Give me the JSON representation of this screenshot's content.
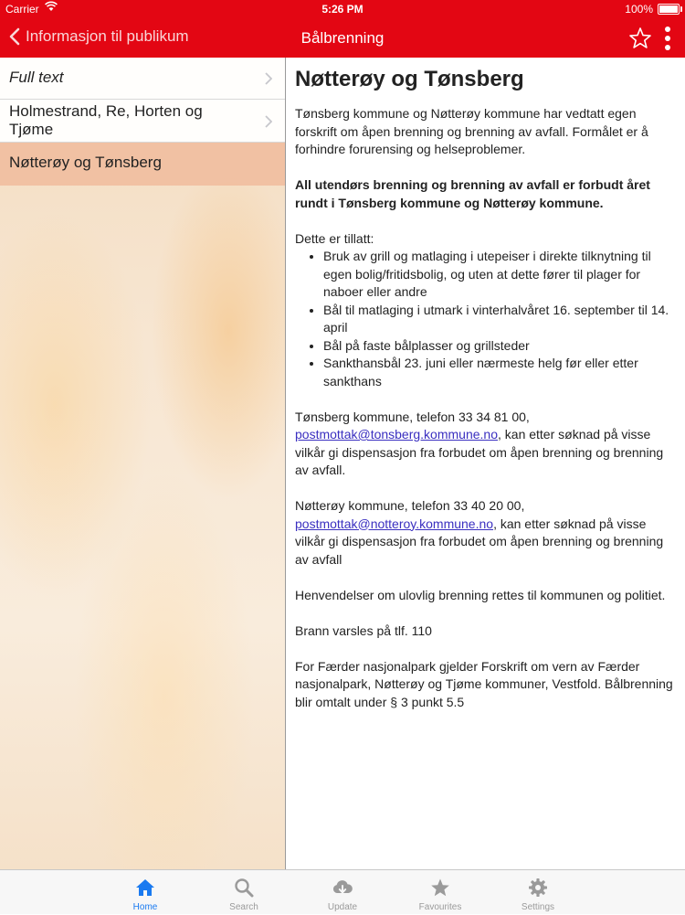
{
  "status_bar": {
    "carrier": "Carrier",
    "time": "5:26 PM",
    "battery": "100%",
    "battery_level": 1.0
  },
  "nav": {
    "back_label": "Informasjon til publikum",
    "title": "Bålbrenning",
    "star_icon": "star-outline-icon",
    "more_icon": "vertical-ellipsis-icon"
  },
  "sidebar": {
    "items": [
      {
        "label": "Full text",
        "has_chevron": true
      },
      {
        "label": "Holmestrand, Re, Horten og Tjøme",
        "has_chevron": true
      },
      {
        "label": "Nøtterøy og Tønsberg",
        "selected": true
      }
    ]
  },
  "content": {
    "heading": "Nøtterøy og Tønsberg",
    "intro": "Tønsberg kommune og Nøtterøy kommune har vedtatt egen forskrift om åpen brenning og brenning av avfall. Formålet er å forhindre forurensing og helseproblemer.",
    "ban": "All utendørs brenning og brenning av avfall er forbudt året rundt i Tønsberg kommune og Nøtterøy kommune.",
    "allowed_heading": "Dette er tillatt:",
    "allowed": [
      "Bruk av grill og matlaging i utepeiser i direkte tilknytning til egen bolig/fritidsbolig, og uten at dette fører til plager for naboer eller andre",
      "Bål til matlaging i utmark i vinterhalvåret 16. september til 14. april",
      "Bål på faste bålplasser og grillsteder",
      "Sankthansbål 23. juni eller nærmeste helg før eller etter sankthans"
    ],
    "tonsberg_prefix": "Tønsberg kommune, telefon 33 34 81 00,",
    "tonsberg_email": "postmottak@tonsberg.kommune.no",
    "tonsberg_suffix": ", kan etter søknad på visse vilkår gi dispensasjon fra forbudet om åpen brenning og brenning av avfall.",
    "notteroy_prefix": "Nøtterøy kommune, telefon 33 40 20 00,",
    "notteroy_email": "postmottak@notteroy.kommune.no",
    "notteroy_suffix": ", kan etter søknad på visse vilkår gi dispensasjon fra forbudet om åpen brenning og brenning av avfall",
    "illegal": "Henvendelser om ulovlig brenning rettes til kommunen og politiet.",
    "fire": "Brann varsles på tlf. 110",
    "faerder": "For Færder nasjonalpark gjelder Forskrift om vern av Færder nasjonalpark, Nøtterøy og Tjøme kommuner, Vestfold. Bålbrenning blir omtalt under § 3 punkt 5.5"
  },
  "tabs": [
    {
      "label": "Home",
      "icon": "home-icon",
      "active": true
    },
    {
      "label": "Search",
      "icon": "search-icon"
    },
    {
      "label": "Update",
      "icon": "cloud-download-icon"
    },
    {
      "label": "Favourites",
      "icon": "star-icon"
    },
    {
      "label": "Settings",
      "icon": "gear-icon"
    }
  ],
  "colors": {
    "brand_red": "#e30613",
    "selected_row": "#f0bea0",
    "tab_active": "#1a7af0",
    "tab_inactive": "#9a9a9a",
    "link": "#3a2fc0"
  }
}
